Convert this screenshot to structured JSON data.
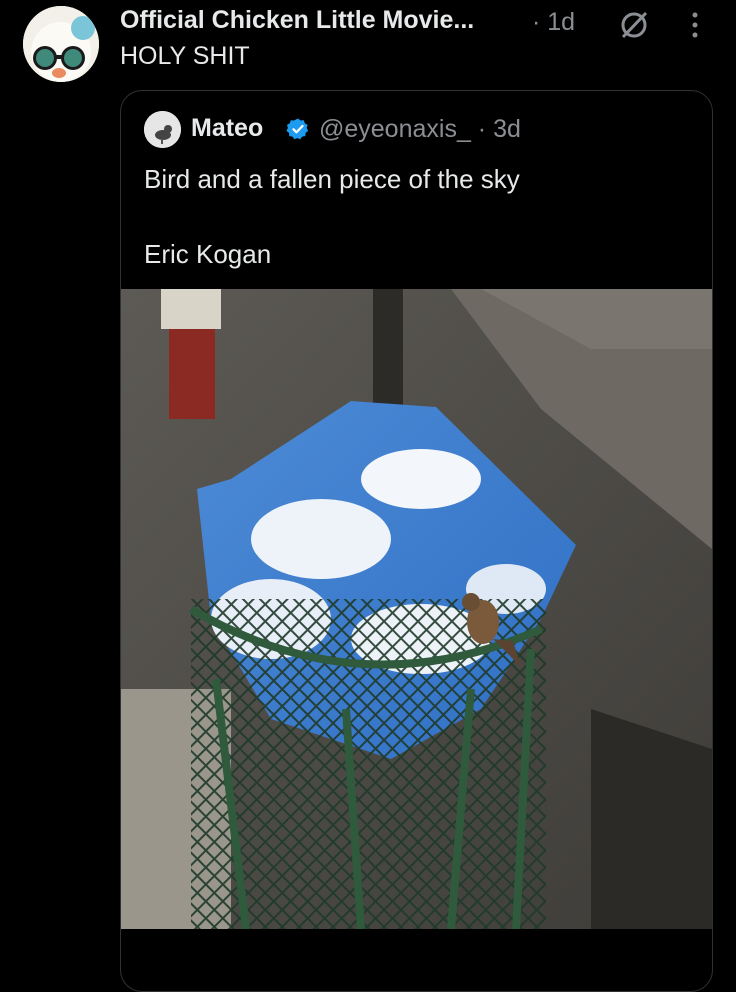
{
  "tweet": {
    "author_name": "Official Chicken Little Movie...",
    "time": "· 1d",
    "text": "HOLY SHIT"
  },
  "quoted": {
    "name": "Mateo",
    "handle": "@eyeonaxis_ · 3d",
    "text_line1": "Bird and a fallen piece of the sky",
    "text_line2": "Eric Kogan"
  },
  "colors": {
    "background": "#000000",
    "primary_text": "#e7e9ea",
    "secondary_text": "#8b8f94",
    "verified": "#1d9bf0"
  },
  "icons": [
    "grok-icon",
    "more-vertical-icon",
    "verified-badge-icon"
  ]
}
